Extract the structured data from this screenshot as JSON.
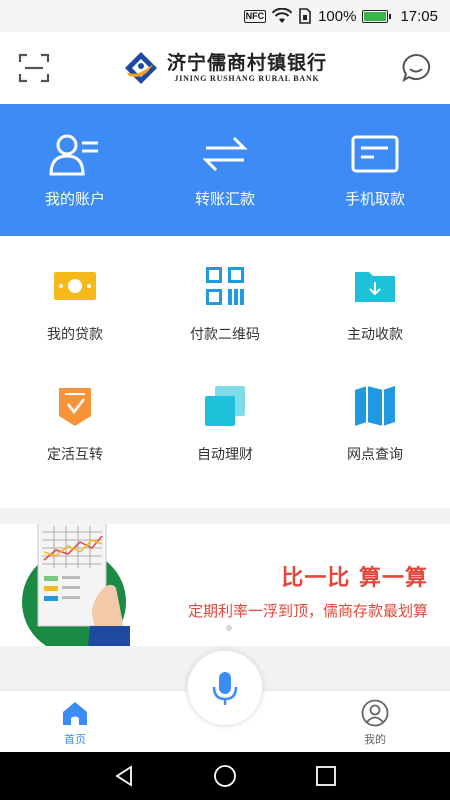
{
  "status_bar": {
    "nfc": "NFC",
    "battery": "100%",
    "time": "17:05",
    "icons": [
      "nfc-icon",
      "wifi-icon",
      "sim-icon",
      "battery-icon"
    ]
  },
  "header": {
    "bank_name_cn": "济宁儒商村镇银行",
    "bank_name_en": "JINING RUSHANG RURAL BANK",
    "left_icon": "scan-icon",
    "right_icon": "chat-bubble-icon"
  },
  "quick_actions": [
    {
      "label": "我的账户",
      "icon": "account-icon"
    },
    {
      "label": "转账汇款",
      "icon": "transfer-icon"
    },
    {
      "label": "手机取款",
      "icon": "card-withdraw-icon"
    }
  ],
  "services": [
    {
      "label": "我的贷款",
      "icon": "loan-icon"
    },
    {
      "label": "付款二维码",
      "icon": "qr-code-icon"
    },
    {
      "label": "主动收款",
      "icon": "receive-folder-icon"
    },
    {
      "label": "定活互转",
      "icon": "deposit-convert-icon"
    },
    {
      "label": "自动理财",
      "icon": "auto-finance-icon"
    },
    {
      "label": "网点查询",
      "icon": "map-icon"
    }
  ],
  "banner": {
    "title": "比一比 算一算",
    "subtitle": "定期利率一浮到顶，儒商存款最划算"
  },
  "tab_bar": {
    "home_label": "首页",
    "mine_label": "我的"
  },
  "colors": {
    "primary_blue": "#3d8bf5",
    "banner_red": "#e1473a",
    "loan_yellow": "#f6b91b",
    "orange": "#f7943a",
    "cyan": "#1fc0d9",
    "green": "#1b8a45"
  }
}
